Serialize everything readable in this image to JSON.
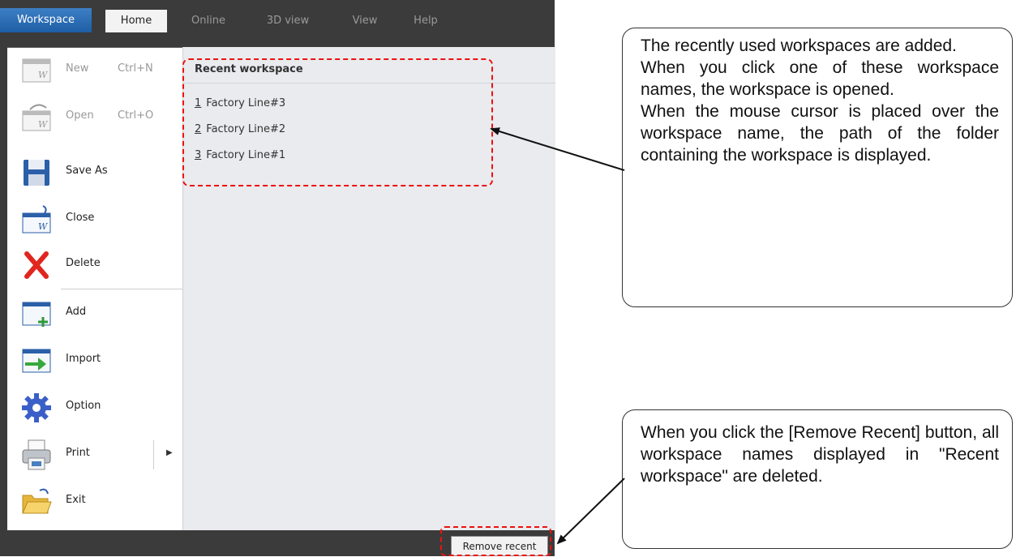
{
  "tabs": {
    "workspace": "Workspace",
    "home": "Home",
    "online": "Online",
    "view3d": "3D view",
    "view": "View",
    "help": "Help"
  },
  "menu": {
    "new": {
      "label": "New",
      "shortcut": "Ctrl+N"
    },
    "open": {
      "label": "Open",
      "shortcut": "Ctrl+O"
    },
    "save_as": "Save As",
    "close": "Close",
    "delete": "Delete",
    "add": "Add",
    "import": "Import",
    "option": "Option",
    "print": "Print",
    "exit": "Exit"
  },
  "recent": {
    "title": "Recent workspace",
    "items": [
      {
        "num": "1",
        "name": "Factory Line#3"
      },
      {
        "num": "2",
        "name": "Factory Line#2"
      },
      {
        "num": "3",
        "name": "Factory Line#1"
      }
    ]
  },
  "remove_recent": "Remove recent",
  "callouts": {
    "recent_lines": [
      "The recently used workspaces are added.",
      "When you click one of these workspace names, the workspace is opened.",
      "When the mouse cursor is placed over the workspace name, the path of the folder containing the workspace is displayed."
    ],
    "remove_text": "When you click the [Remove Recent] button, all workspace names displayed in \"Recent workspace\" are deleted."
  },
  "colors": {
    "highlight": "#ee1111",
    "workspace_tab": "#2a6db5",
    "ribbon_dark": "#3b3b3b"
  }
}
